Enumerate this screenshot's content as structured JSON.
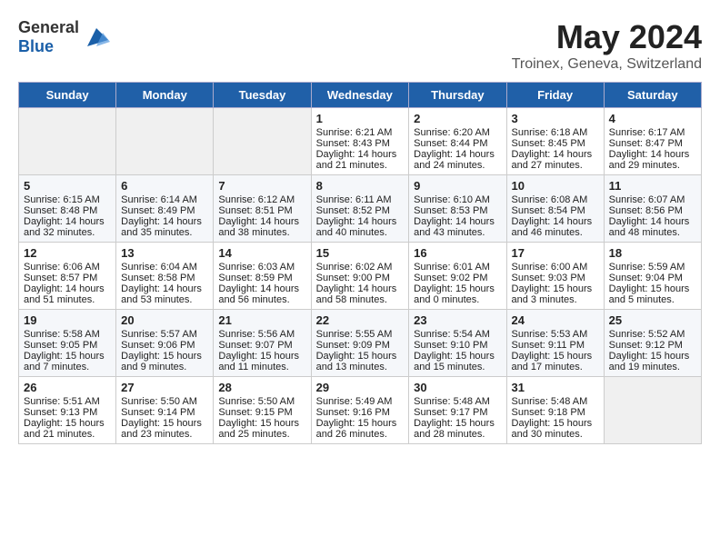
{
  "logo": {
    "general": "General",
    "blue": "Blue"
  },
  "title": "May 2024",
  "subtitle": "Troinex, Geneva, Switzerland",
  "weekdays": [
    "Sunday",
    "Monday",
    "Tuesday",
    "Wednesday",
    "Thursday",
    "Friday",
    "Saturday"
  ],
  "weeks": [
    [
      {
        "day": "",
        "sunrise": "",
        "sunset": "",
        "daylight": ""
      },
      {
        "day": "",
        "sunrise": "",
        "sunset": "",
        "daylight": ""
      },
      {
        "day": "",
        "sunrise": "",
        "sunset": "",
        "daylight": ""
      },
      {
        "day": "1",
        "sunrise": "Sunrise: 6:21 AM",
        "sunset": "Sunset: 8:43 PM",
        "daylight": "Daylight: 14 hours and 21 minutes."
      },
      {
        "day": "2",
        "sunrise": "Sunrise: 6:20 AM",
        "sunset": "Sunset: 8:44 PM",
        "daylight": "Daylight: 14 hours and 24 minutes."
      },
      {
        "day": "3",
        "sunrise": "Sunrise: 6:18 AM",
        "sunset": "Sunset: 8:45 PM",
        "daylight": "Daylight: 14 hours and 27 minutes."
      },
      {
        "day": "4",
        "sunrise": "Sunrise: 6:17 AM",
        "sunset": "Sunset: 8:47 PM",
        "daylight": "Daylight: 14 hours and 29 minutes."
      }
    ],
    [
      {
        "day": "5",
        "sunrise": "Sunrise: 6:15 AM",
        "sunset": "Sunset: 8:48 PM",
        "daylight": "Daylight: 14 hours and 32 minutes."
      },
      {
        "day": "6",
        "sunrise": "Sunrise: 6:14 AM",
        "sunset": "Sunset: 8:49 PM",
        "daylight": "Daylight: 14 hours and 35 minutes."
      },
      {
        "day": "7",
        "sunrise": "Sunrise: 6:12 AM",
        "sunset": "Sunset: 8:51 PM",
        "daylight": "Daylight: 14 hours and 38 minutes."
      },
      {
        "day": "8",
        "sunrise": "Sunrise: 6:11 AM",
        "sunset": "Sunset: 8:52 PM",
        "daylight": "Daylight: 14 hours and 40 minutes."
      },
      {
        "day": "9",
        "sunrise": "Sunrise: 6:10 AM",
        "sunset": "Sunset: 8:53 PM",
        "daylight": "Daylight: 14 hours and 43 minutes."
      },
      {
        "day": "10",
        "sunrise": "Sunrise: 6:08 AM",
        "sunset": "Sunset: 8:54 PM",
        "daylight": "Daylight: 14 hours and 46 minutes."
      },
      {
        "day": "11",
        "sunrise": "Sunrise: 6:07 AM",
        "sunset": "Sunset: 8:56 PM",
        "daylight": "Daylight: 14 hours and 48 minutes."
      }
    ],
    [
      {
        "day": "12",
        "sunrise": "Sunrise: 6:06 AM",
        "sunset": "Sunset: 8:57 PM",
        "daylight": "Daylight: 14 hours and 51 minutes."
      },
      {
        "day": "13",
        "sunrise": "Sunrise: 6:04 AM",
        "sunset": "Sunset: 8:58 PM",
        "daylight": "Daylight: 14 hours and 53 minutes."
      },
      {
        "day": "14",
        "sunrise": "Sunrise: 6:03 AM",
        "sunset": "Sunset: 8:59 PM",
        "daylight": "Daylight: 14 hours and 56 minutes."
      },
      {
        "day": "15",
        "sunrise": "Sunrise: 6:02 AM",
        "sunset": "Sunset: 9:00 PM",
        "daylight": "Daylight: 14 hours and 58 minutes."
      },
      {
        "day": "16",
        "sunrise": "Sunrise: 6:01 AM",
        "sunset": "Sunset: 9:02 PM",
        "daylight": "Daylight: 15 hours and 0 minutes."
      },
      {
        "day": "17",
        "sunrise": "Sunrise: 6:00 AM",
        "sunset": "Sunset: 9:03 PM",
        "daylight": "Daylight: 15 hours and 3 minutes."
      },
      {
        "day": "18",
        "sunrise": "Sunrise: 5:59 AM",
        "sunset": "Sunset: 9:04 PM",
        "daylight": "Daylight: 15 hours and 5 minutes."
      }
    ],
    [
      {
        "day": "19",
        "sunrise": "Sunrise: 5:58 AM",
        "sunset": "Sunset: 9:05 PM",
        "daylight": "Daylight: 15 hours and 7 minutes."
      },
      {
        "day": "20",
        "sunrise": "Sunrise: 5:57 AM",
        "sunset": "Sunset: 9:06 PM",
        "daylight": "Daylight: 15 hours and 9 minutes."
      },
      {
        "day": "21",
        "sunrise": "Sunrise: 5:56 AM",
        "sunset": "Sunset: 9:07 PM",
        "daylight": "Daylight: 15 hours and 11 minutes."
      },
      {
        "day": "22",
        "sunrise": "Sunrise: 5:55 AM",
        "sunset": "Sunset: 9:09 PM",
        "daylight": "Daylight: 15 hours and 13 minutes."
      },
      {
        "day": "23",
        "sunrise": "Sunrise: 5:54 AM",
        "sunset": "Sunset: 9:10 PM",
        "daylight": "Daylight: 15 hours and 15 minutes."
      },
      {
        "day": "24",
        "sunrise": "Sunrise: 5:53 AM",
        "sunset": "Sunset: 9:11 PM",
        "daylight": "Daylight: 15 hours and 17 minutes."
      },
      {
        "day": "25",
        "sunrise": "Sunrise: 5:52 AM",
        "sunset": "Sunset: 9:12 PM",
        "daylight": "Daylight: 15 hours and 19 minutes."
      }
    ],
    [
      {
        "day": "26",
        "sunrise": "Sunrise: 5:51 AM",
        "sunset": "Sunset: 9:13 PM",
        "daylight": "Daylight: 15 hours and 21 minutes."
      },
      {
        "day": "27",
        "sunrise": "Sunrise: 5:50 AM",
        "sunset": "Sunset: 9:14 PM",
        "daylight": "Daylight: 15 hours and 23 minutes."
      },
      {
        "day": "28",
        "sunrise": "Sunrise: 5:50 AM",
        "sunset": "Sunset: 9:15 PM",
        "daylight": "Daylight: 15 hours and 25 minutes."
      },
      {
        "day": "29",
        "sunrise": "Sunrise: 5:49 AM",
        "sunset": "Sunset: 9:16 PM",
        "daylight": "Daylight: 15 hours and 26 minutes."
      },
      {
        "day": "30",
        "sunrise": "Sunrise: 5:48 AM",
        "sunset": "Sunset: 9:17 PM",
        "daylight": "Daylight: 15 hours and 28 minutes."
      },
      {
        "day": "31",
        "sunrise": "Sunrise: 5:48 AM",
        "sunset": "Sunset: 9:18 PM",
        "daylight": "Daylight: 15 hours and 30 minutes."
      },
      {
        "day": "",
        "sunrise": "",
        "sunset": "",
        "daylight": ""
      }
    ]
  ]
}
